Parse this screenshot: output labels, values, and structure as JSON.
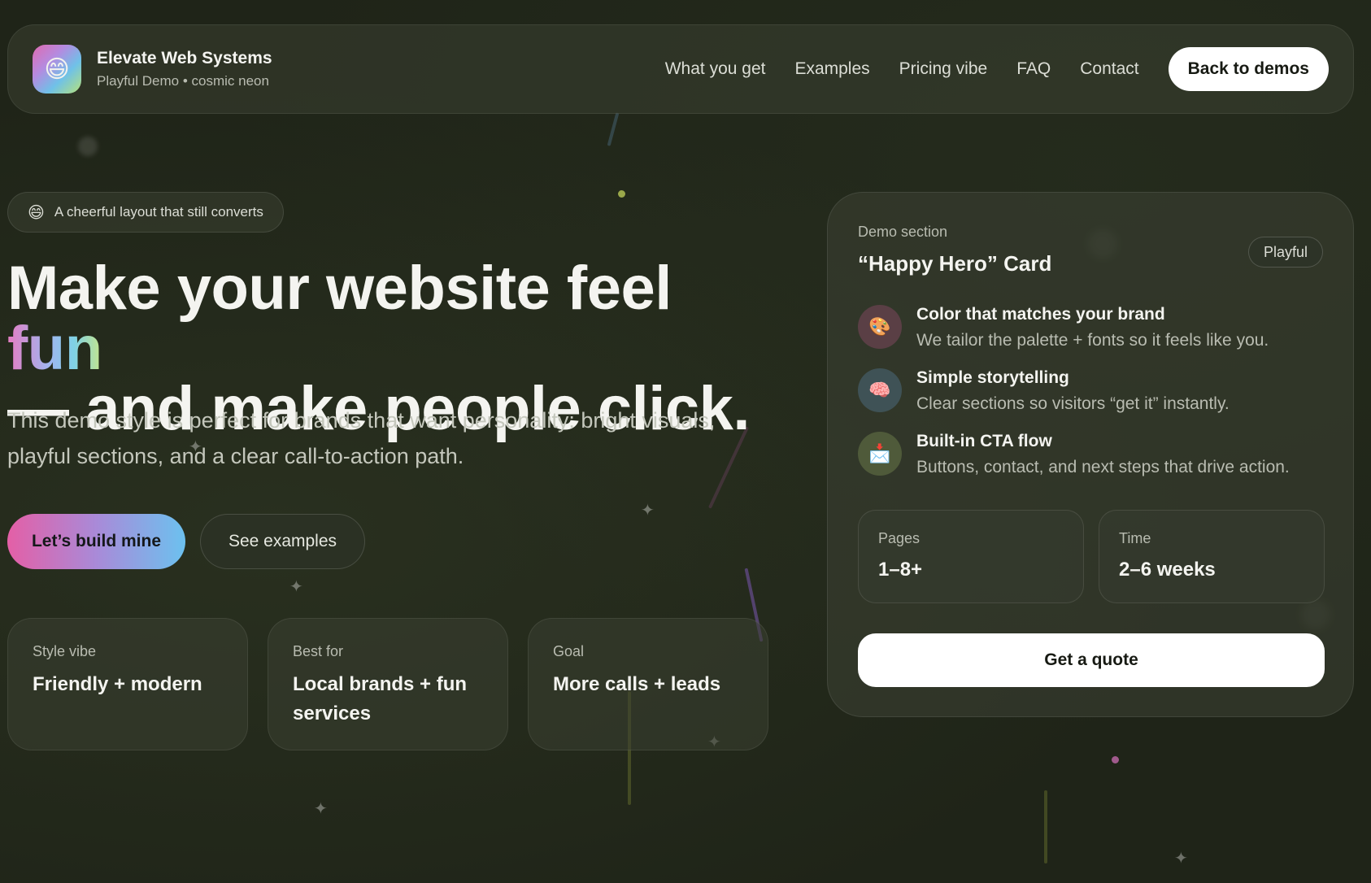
{
  "header": {
    "logo_emoji": "😄",
    "brand_name": "Elevate Web Systems",
    "brand_sub": "Playful Demo • cosmic neon",
    "nav": [
      "What you get",
      "Examples",
      "Pricing vibe",
      "FAQ",
      "Contact"
    ],
    "back_label": "Back to demos"
  },
  "hero": {
    "pill_emoji": "😄",
    "pill_text": "A cheerful layout that still converts",
    "headline_pre": "Make your website feel ",
    "headline_fun": "fun",
    "headline_post": "— and make people click.",
    "lead": "This demo style is perfect for brands that want personality: bright visuals, playful sections, and a clear call-to-action path.",
    "primary_cta": "Let’s build mine",
    "secondary_cta": "See examples",
    "stats": [
      {
        "label": "Style vibe",
        "value": "Friendly + modern"
      },
      {
        "label": "Best for",
        "value": "Local brands + fun services"
      },
      {
        "label": "Goal",
        "value": "More calls + leads"
      }
    ]
  },
  "demo_card": {
    "eyebrow": "Demo section",
    "title": "“Happy Hero” Card",
    "badge": "Playful",
    "features": [
      {
        "icon": "🎨",
        "icon_name": "palette-icon",
        "title": "Color that matches your brand",
        "desc": "We tailor the palette + fonts so it feels like you."
      },
      {
        "icon": "🧠",
        "icon_name": "brain-icon",
        "title": "Simple storytelling",
        "desc": "Clear sections so visitors “get it” instantly."
      },
      {
        "icon": "📩",
        "icon_name": "envelope-icon",
        "title": "Built-in CTA flow",
        "desc": "Buttons, contact, and next steps that drive action."
      }
    ],
    "mini": [
      {
        "label": "Pages",
        "value": "1–8+"
      },
      {
        "label": "Time",
        "value": "2–6 weeks"
      }
    ],
    "quote_label": "Get a quote"
  },
  "colors": {
    "background": "#1f2418",
    "accent_pink": "#e45fa6",
    "accent_blue": "#6cc1ef",
    "accent_lime": "#c6e68a"
  }
}
